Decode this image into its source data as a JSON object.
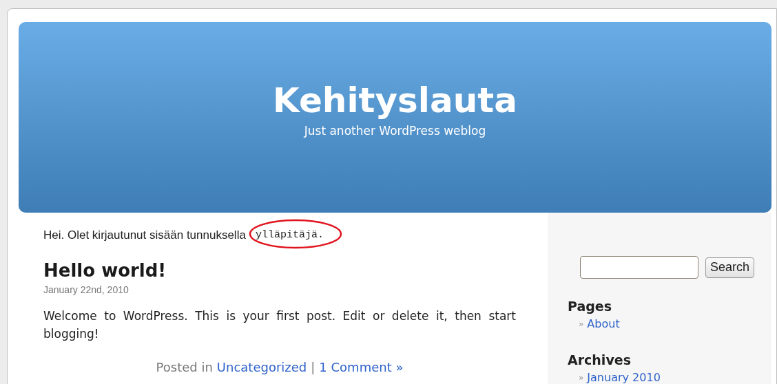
{
  "header": {
    "title": "Kehityslauta",
    "tagline": "Just another WordPress weblog"
  },
  "login_notice": {
    "text": "Hei. Olet kirjautunut sisään tunnuksella",
    "username": "ylläpitäjä."
  },
  "post": {
    "title": "Hello world!",
    "date": "January 22nd, 2010",
    "body": "Welcome to WordPress. This is your first post. Edit or delete it, then start blogging!",
    "meta": {
      "prefix": "Posted in",
      "category": "Uncategorized",
      "separator": "|",
      "comments": "1 Comment »"
    }
  },
  "sidebar": {
    "search": {
      "button": "Search"
    },
    "sections": [
      {
        "title": "Pages",
        "items": [
          {
            "bullet": "»",
            "label": "About"
          }
        ]
      },
      {
        "title": "Archives",
        "items": [
          {
            "bullet": "»",
            "label": "January 2010"
          }
        ]
      }
    ]
  }
}
